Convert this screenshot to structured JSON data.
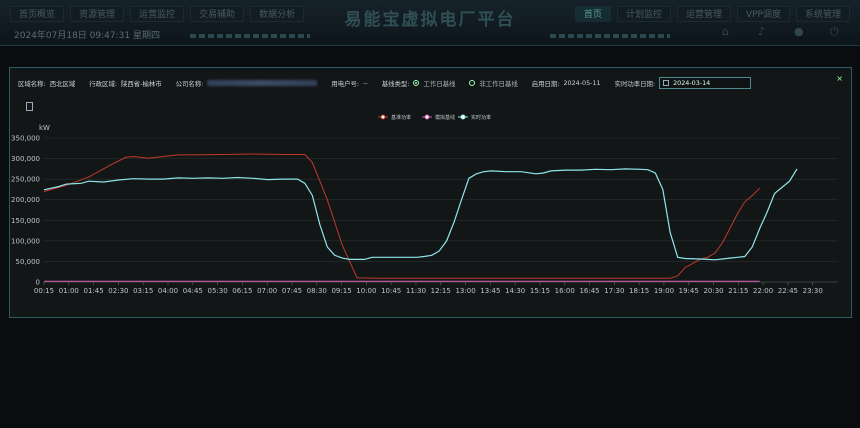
{
  "header": {
    "title": "易能宝虚拟电厂平台",
    "nav_left": [
      "首页概览",
      "资源管理",
      "运营监控",
      "交易辅助",
      "数据分析"
    ],
    "nav_right": [
      "首页",
      "计划监控",
      "运营管理",
      "VPP调度",
      "系统管理"
    ],
    "datetime": "2024年07月18日  09:47:31  星期四",
    "icons": [
      "home-icon",
      "bell-icon",
      "user-icon",
      "logout-icon"
    ]
  },
  "filters": {
    "region_label": "区域名称:",
    "region_value": "西北区域",
    "admin_label": "行政区域:",
    "admin_value": "陕西省-榆林市",
    "company_label": "公司名称:",
    "user_label": "用电户号:",
    "user_value": "--",
    "baseline_label": "基线类型:",
    "baseline_options": [
      "工作日基线",
      "非工作日基线"
    ],
    "baseline_selected": "工作日基线",
    "apply_label": "启用日期:",
    "apply_value": "2024-05-11",
    "realtime_label": "实时功率日期:",
    "realtime_value": "2024-03-14"
  },
  "chart_data": {
    "type": "line",
    "ylabel": "kW",
    "ylim": [
      0,
      350000
    ],
    "yticks": [
      0,
      50000,
      100000,
      150000,
      200000,
      250000,
      300000,
      350000
    ],
    "ytick_labels": [
      "0",
      "50,000",
      "100,000",
      "150,000",
      "200,000",
      "250,000",
      "300,000",
      "350,000"
    ],
    "xtick_labels": [
      "00:15",
      "01:00",
      "01:45",
      "02:30",
      "03:15",
      "04:00",
      "04:45",
      "05:30",
      "06:15",
      "07:00",
      "07:45",
      "08:30",
      "09:15",
      "10:00",
      "10:45",
      "11:30",
      "12:15",
      "13:00",
      "13:45",
      "14:30",
      "15:15",
      "16:00",
      "16:45",
      "17:30",
      "18:15",
      "19:00",
      "19:45",
      "20:30",
      "21:15",
      "22:00",
      "22:45",
      "23:30"
    ],
    "x_slots": 96,
    "legend": [
      "基准功率",
      "模拟基线",
      "实时功率"
    ],
    "series": [
      {
        "name": "基准功率",
        "color": "#c0392b",
        "points": [
          [
            0,
            220000
          ],
          [
            3,
            235000
          ],
          [
            6,
            255000
          ],
          [
            9,
            285000
          ],
          [
            11,
            303000
          ],
          [
            12,
            305000
          ],
          [
            14,
            301000
          ],
          [
            16,
            305000
          ],
          [
            18,
            309000
          ],
          [
            20,
            309000
          ],
          [
            24,
            310000
          ],
          [
            28,
            311000
          ],
          [
            32,
            310000
          ],
          [
            35,
            310000
          ],
          [
            36,
            290000
          ],
          [
            38,
            200000
          ],
          [
            40,
            90000
          ],
          [
            42,
            10000
          ],
          [
            46,
            9000
          ],
          [
            60,
            9000
          ],
          [
            70,
            9000
          ],
          [
            80,
            9000
          ],
          [
            84,
            9000
          ],
          [
            85,
            15000
          ],
          [
            86,
            35000
          ],
          [
            88,
            55000
          ],
          [
            89,
            60000
          ],
          [
            90,
            70000
          ],
          [
            91,
            95000
          ],
          [
            92,
            130000
          ],
          [
            93,
            165000
          ],
          [
            94,
            195000
          ],
          [
            95,
            210000
          ],
          [
            96,
            228000
          ]
        ]
      },
      {
        "name": "模拟基线",
        "color": "#d65db1",
        "points": [
          [
            0,
            2000
          ],
          [
            96,
            2000
          ]
        ]
      },
      {
        "name": "实时功率",
        "color": "#8ee6ea",
        "points": [
          [
            0,
            224000
          ],
          [
            2,
            232000
          ],
          [
            3,
            238000
          ],
          [
            5,
            240000
          ],
          [
            6,
            245000
          ],
          [
            8,
            243000
          ],
          [
            10,
            248000
          ],
          [
            12,
            251000
          ],
          [
            14,
            250000
          ],
          [
            16,
            250000
          ],
          [
            18,
            253000
          ],
          [
            20,
            252000
          ],
          [
            22,
            253000
          ],
          [
            24,
            252000
          ],
          [
            26,
            254000
          ],
          [
            28,
            252000
          ],
          [
            30,
            249000
          ],
          [
            32,
            250000
          ],
          [
            34,
            250000
          ],
          [
            35,
            240000
          ],
          [
            36,
            210000
          ],
          [
            37,
            140000
          ],
          [
            38,
            85000
          ],
          [
            39,
            65000
          ],
          [
            40,
            58000
          ],
          [
            41,
            55000
          ],
          [
            43,
            55000
          ],
          [
            44,
            60000
          ],
          [
            46,
            60000
          ],
          [
            50,
            60000
          ],
          [
            51,
            62000
          ],
          [
            52,
            65000
          ],
          [
            53,
            75000
          ],
          [
            54,
            100000
          ],
          [
            55,
            145000
          ],
          [
            56,
            200000
          ],
          [
            57,
            252000
          ],
          [
            58,
            263000
          ],
          [
            59,
            268000
          ],
          [
            60,
            270000
          ],
          [
            62,
            268000
          ],
          [
            64,
            268000
          ],
          [
            66,
            263000
          ],
          [
            67,
            265000
          ],
          [
            68,
            270000
          ],
          [
            70,
            272000
          ],
          [
            72,
            272000
          ],
          [
            74,
            274000
          ],
          [
            76,
            273000
          ],
          [
            78,
            275000
          ],
          [
            80,
            274000
          ],
          [
            81,
            273000
          ],
          [
            82,
            265000
          ],
          [
            83,
            225000
          ],
          [
            84,
            120000
          ],
          [
            85,
            60000
          ],
          [
            86,
            57000
          ],
          [
            88,
            56000
          ],
          [
            89,
            55000
          ],
          [
            90,
            54000
          ],
          [
            91,
            56000
          ],
          [
            92,
            58000
          ],
          [
            93,
            60000
          ],
          [
            94,
            62000
          ],
          [
            95,
            85000
          ],
          [
            96,
            130000
          ],
          [
            97,
            170000
          ],
          [
            98,
            215000
          ],
          [
            99,
            230000
          ],
          [
            100,
            245000
          ],
          [
            101,
            275000
          ]
        ]
      }
    ]
  }
}
